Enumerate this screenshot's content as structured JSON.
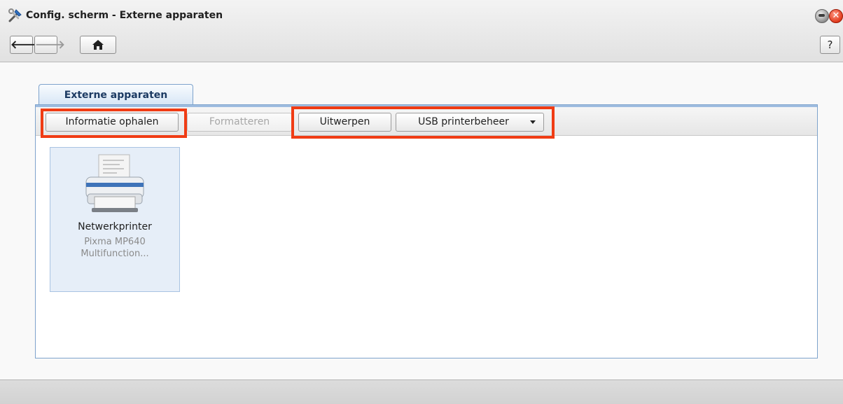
{
  "window": {
    "title": "Config. scherm - Externe apparaten",
    "icon": "tools-icon",
    "close_glyph": "✕"
  },
  "nav": {
    "back_glyph": "🡐",
    "forward_glyph": "🡒",
    "home_icon": "home-icon",
    "help_label": "?"
  },
  "tabs": [
    {
      "label": "Externe apparaten",
      "active": true
    }
  ],
  "toolbar": {
    "get_info_label": "Informatie ophalen",
    "format_label": "Formatteren",
    "eject_label": "Uitwerpen",
    "usb_printer_label": "USB printerbeheer"
  },
  "devices": [
    {
      "name": "Netwerkprinter",
      "model": "Pixma MP640",
      "description": "Multifunction...",
      "icon": "printer-icon"
    }
  ],
  "colors": {
    "highlight": "#f03c14",
    "tab_border": "#7ea3cc",
    "device_selected_bg": "#e6eef8"
  }
}
